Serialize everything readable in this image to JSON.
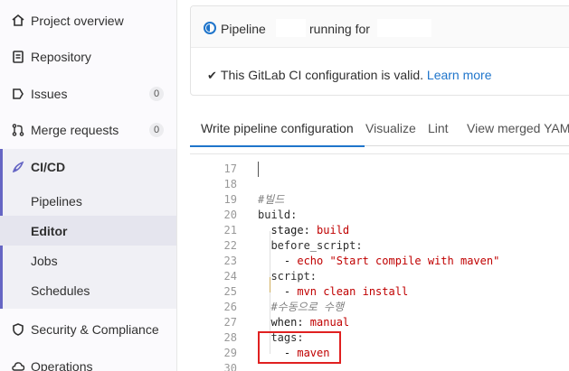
{
  "sidebar": {
    "items": [
      {
        "label": "Project overview",
        "icon": "home-icon"
      },
      {
        "label": "Repository",
        "icon": "document-icon"
      },
      {
        "label": "Issues",
        "icon": "issues-icon",
        "count": "0"
      },
      {
        "label": "Merge requests",
        "icon": "merge-request-icon",
        "count": "0"
      }
    ],
    "cicd": {
      "label": "CI/CD",
      "icon": "rocket-icon",
      "subitems": [
        "Pipelines",
        "Editor",
        "Jobs",
        "Schedules"
      ],
      "active": "Editor"
    },
    "items_after": [
      {
        "label": "Security & Compliance",
        "icon": "shield-icon"
      },
      {
        "label": "Operations",
        "icon": "cloud-icon"
      }
    ]
  },
  "status": {
    "pipeline_word": "Pipeline",
    "running_for": "running for",
    "valid_text": "This GitLab CI configuration is valid.",
    "learn_more": "Learn more"
  },
  "tabs": [
    "Write pipeline configuration",
    "Visualize",
    "Lint",
    "View merged YAML"
  ],
  "editor": {
    "lines": [
      {
        "n": "17",
        "code": ""
      },
      {
        "n": "18",
        "code": ""
      },
      {
        "n": "19",
        "code": "#빌드"
      },
      {
        "n": "20",
        "code": "build:"
      },
      {
        "n": "21",
        "key": "  stage: ",
        "val": "build"
      },
      {
        "n": "22",
        "code": "  before_script:"
      },
      {
        "n": "23",
        "key": "    - ",
        "val": "echo \"Start compile with maven\""
      },
      {
        "n": "24",
        "code": "  script:"
      },
      {
        "n": "25",
        "key": "    - ",
        "val": "mvn clean install"
      },
      {
        "n": "26",
        "code": "  #수동으로 수행"
      },
      {
        "n": "27",
        "key": "  when: ",
        "val": "manual"
      },
      {
        "n": "28",
        "code": "  tags:"
      },
      {
        "n": "29",
        "key": "    - ",
        "val": "maven"
      },
      {
        "n": "30",
        "code": ""
      }
    ]
  },
  "colors": {
    "accent": "#1f75cb",
    "cicd_bar": "#6666c4",
    "yaml_value": "#c00000",
    "highlight_box": "#e02020"
  }
}
